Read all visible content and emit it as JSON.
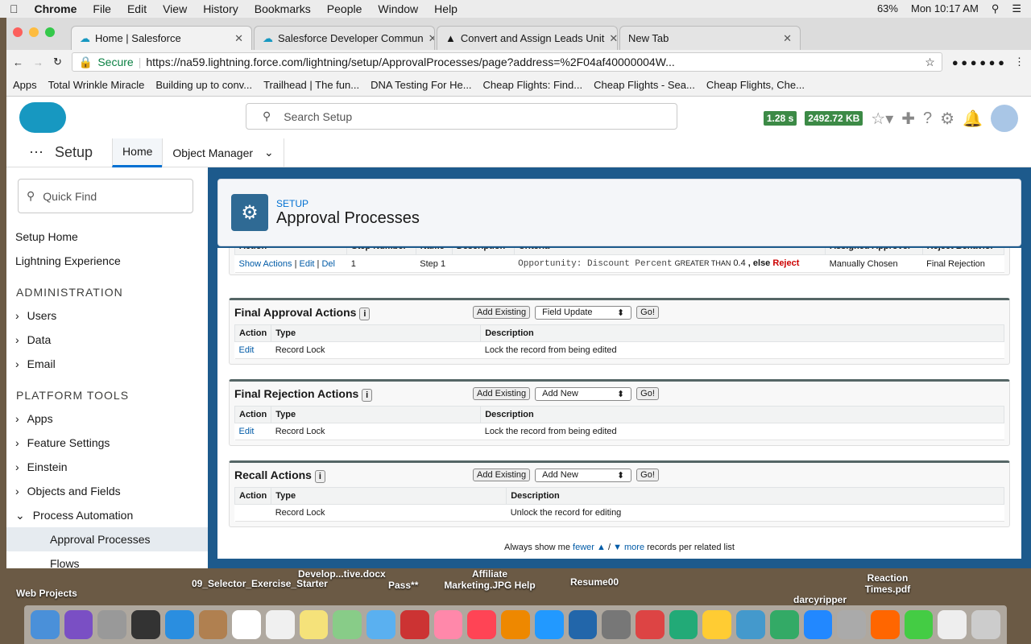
{
  "menubar": {
    "app": "Chrome",
    "items": [
      "File",
      "Edit",
      "View",
      "History",
      "Bookmarks",
      "People",
      "Window",
      "Help"
    ],
    "battery": "63%",
    "clock": "Mon 10:17 AM"
  },
  "browser": {
    "tabs": [
      "Home | Salesforce",
      "Salesforce Developer Commun",
      "Convert and Assign Leads Unit",
      "New Tab"
    ],
    "secure": "Secure",
    "url": "https://na59.lightning.force.com/lightning/setup/ApprovalProcesses/page?address=%2F04af40000004W...",
    "bookmarks": [
      "Apps",
      "Total Wrinkle Miracle",
      "Building up to conv...",
      "Trailhead | The fun...",
      "DNA Testing For He...",
      "Cheap Flights: Find...",
      "Cheap Flights - Sea...",
      "Cheap Flights, Che..."
    ]
  },
  "header": {
    "search_placeholder": "Search Setup",
    "time": "1.28 s",
    "size": "2492.72 KB"
  },
  "nav": {
    "app": "Setup",
    "home": "Home",
    "object_manager": "Object Manager"
  },
  "sidebar": {
    "quick_find": "Quick Find",
    "setup_home": "Setup Home",
    "lightning": "Lightning Experience",
    "admin": "ADMINISTRATION",
    "admin_items": [
      "Users",
      "Data",
      "Email"
    ],
    "platform": "PLATFORM TOOLS",
    "platform_items": [
      "Apps",
      "Feature Settings",
      "Einstein",
      "Objects and Fields",
      "Process Automation"
    ],
    "approval": "Approval Processes",
    "flows": "Flows"
  },
  "page": {
    "eyebrow": "SETUP",
    "title": "Approval Processes"
  },
  "steps": {
    "headers": [
      "Action",
      "Step Number",
      "Name",
      "Description",
      "Criteria",
      "Assigned Approver",
      "Reject Behavior"
    ],
    "row": {
      "show": "Show Actions",
      "edit": "Edit",
      "del": "Del",
      "num": "1",
      "name": "Step 1",
      "criteria_field": "Opportunity: Discount Percent",
      "op": "GREATER THAN",
      "val": "0.4",
      "else": ", else",
      "reject": "Reject",
      "approver": "Manually Chosen",
      "behavior": "Final Rejection"
    }
  },
  "sections": [
    {
      "title": "Final Approval Actions",
      "add": "Add Existing",
      "select": "Field Update",
      "go": "Go!",
      "h": [
        "Action",
        "Type",
        "Description"
      ],
      "edit": "Edit",
      "type": "Record Lock",
      "desc": "Lock the record from being edited"
    },
    {
      "title": "Final Rejection Actions",
      "add": "Add Existing",
      "select": "Add New",
      "go": "Go!",
      "h": [
        "Action",
        "Type",
        "Description"
      ],
      "edit": "Edit",
      "type": "Record Lock",
      "desc": "Lock the record from being edited"
    },
    {
      "title": "Recall Actions",
      "add": "Add Existing",
      "select": "Add New",
      "go": "Go!",
      "h": [
        "Action",
        "Type",
        "Description"
      ],
      "edit": "",
      "type": "Record Lock",
      "desc": "Unlock the record for editing"
    }
  ],
  "footer": {
    "pre": "Always show me",
    "fewer": "fewer",
    "sep": "/",
    "more": "more",
    "post": "records per related list"
  },
  "desktop": [
    "Web Projects",
    "09_Selector_Exercise_Starter",
    "Develop...tive.docx",
    "Affiliate Marketing.JPG Help",
    "Pass**",
    "Resume00",
    "darcyripper",
    "Reaction Times.pdf"
  ]
}
